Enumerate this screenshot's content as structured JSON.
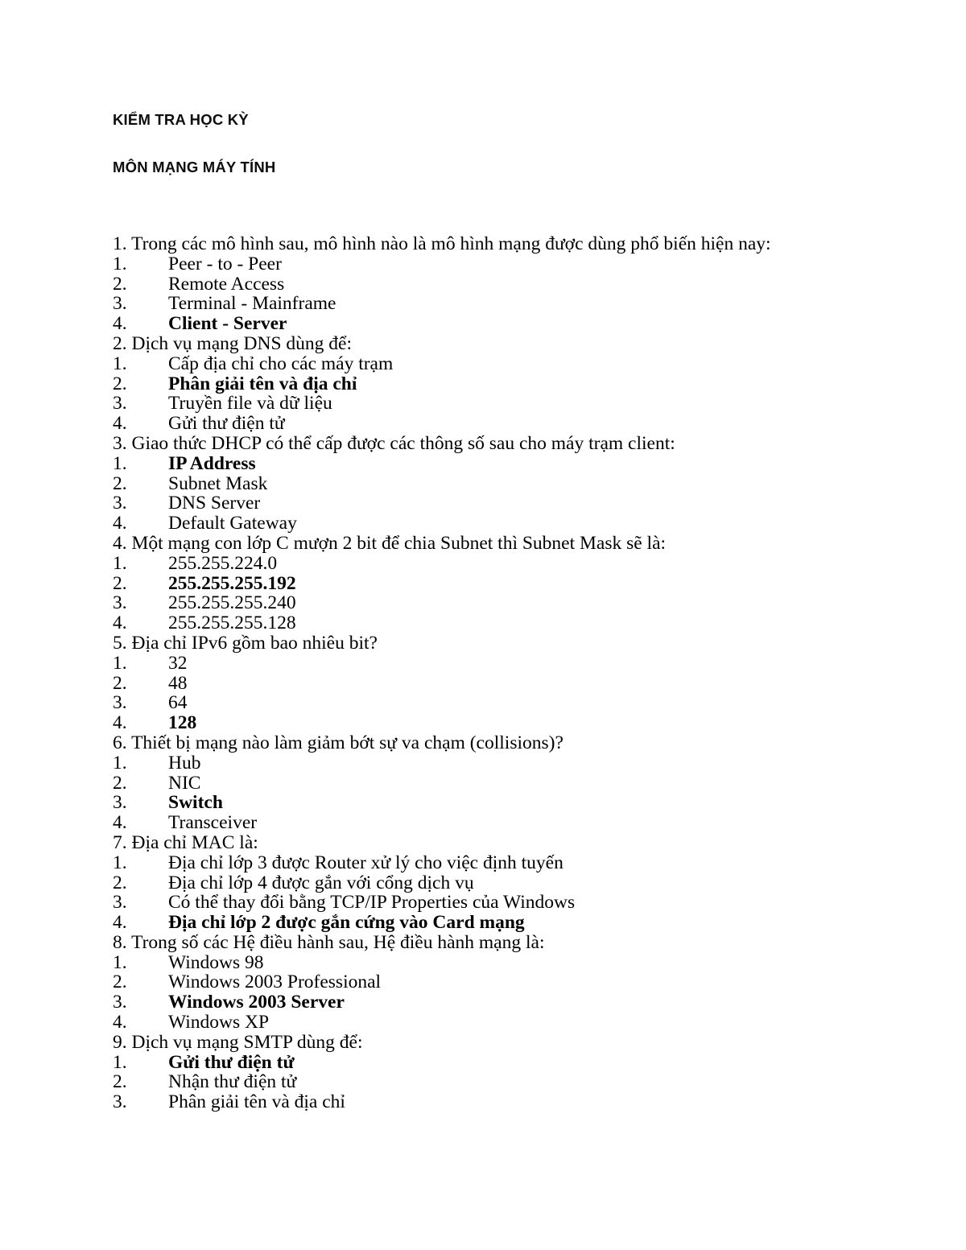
{
  "document": {
    "title_line_1": "KIỂM TRA HỌC KỲ",
    "title_line_2": "MÔN MẠNG MÁY TÍNH"
  },
  "questions": [
    {
      "number": "1.",
      "text": "Trong các mô hình sau, mô hình nào là mô hình mạng được dùng phổ biến hiện nay:",
      "options": [
        {
          "number": "1.",
          "text": "Peer - to - Peer",
          "correct": false
        },
        {
          "number": "2.",
          "text": "Remote Access",
          "correct": false
        },
        {
          "number": "3.",
          "text": "Terminal - Mainframe",
          "correct": false
        },
        {
          "number": "4.",
          "text": "Client - Server",
          "correct": true
        }
      ]
    },
    {
      "number": "2.",
      "text": "Dịch vụ mạng DNS dùng để:",
      "options": [
        {
          "number": "1.",
          "text": "Cấp địa chỉ cho các máy trạm",
          "correct": false
        },
        {
          "number": "2.",
          "text": "Phân giải tên và địa chỉ",
          "correct": true
        },
        {
          "number": "3.",
          "text": "Truyền file và dữ liệu",
          "correct": false
        },
        {
          "number": "4.",
          "text": "Gửi thư điện tử",
          "correct": false
        }
      ]
    },
    {
      "number": "3.",
      "text": "Giao thức DHCP có thể cấp được các thông số sau cho máy trạm client:",
      "options": [
        {
          "number": "1.",
          "text": "IP Address",
          "correct": true
        },
        {
          "number": "2.",
          "text": "Subnet Mask",
          "correct": false
        },
        {
          "number": "3.",
          "text": "DNS Server",
          "correct": false
        },
        {
          "number": "4.",
          "text": "Default Gateway",
          "correct": false
        }
      ]
    },
    {
      "number": "4.",
      "text": "Một mạng con lớp C mượn 2 bit để chia Subnet thì Subnet Mask sẽ là:",
      "options": [
        {
          "number": "1.",
          "text": "255.255.224.0",
          "correct": false
        },
        {
          "number": "2.",
          "text": "255.255.255.192",
          "correct": true
        },
        {
          "number": "3.",
          "text": "255.255.255.240",
          "correct": false
        },
        {
          "number": "4.",
          "text": "255.255.255.128",
          "correct": false
        }
      ]
    },
    {
      "number": "5.",
      "text": "Địa chỉ IPv6 gồm bao nhiêu bit?",
      "options": [
        {
          "number": "1.",
          "text": "32",
          "correct": false
        },
        {
          "number": "2.",
          "text": "48",
          "correct": false
        },
        {
          "number": "3.",
          "text": "64",
          "correct": false
        },
        {
          "number": "4.",
          "text": "128",
          "correct": true
        }
      ]
    },
    {
      "number": "6.",
      "text": "Thiết bị mạng nào làm giảm bớt sự va chạm (collisions)?",
      "options": [
        {
          "number": "1.",
          "text": "Hub",
          "correct": false
        },
        {
          "number": "2.",
          "text": "NIC",
          "correct": false
        },
        {
          "number": "3.",
          "text": "Switch",
          "correct": true
        },
        {
          "number": "4.",
          "text": "Transceiver",
          "correct": false
        }
      ]
    },
    {
      "number": "7.",
      "text": "Địa chỉ MAC là:",
      "options": [
        {
          "number": "1.",
          "text": "Địa chỉ lớp 3 được Router xử lý cho việc định tuyến",
          "correct": false
        },
        {
          "number": "2.",
          "text": "Địa chỉ lớp 4 được gắn với cổng dịch vụ",
          "correct": false
        },
        {
          "number": "3.",
          "text": "Có thể thay đổi bằng TCP/IP Properties của Windows",
          "correct": false
        },
        {
          "number": "4.",
          "text": "Địa chỉ lớp 2 được gắn cứng vào Card mạng",
          "correct": true
        }
      ]
    },
    {
      "number": "8.",
      "text": "Trong số các Hệ điều hành sau, Hệ điều hành mạng là:",
      "options": [
        {
          "number": "1.",
          "text": "Windows 98",
          "correct": false
        },
        {
          "number": "2.",
          "text": "Windows 2003 Professional",
          "correct": false
        },
        {
          "number": "3.",
          "text": "Windows 2003 Server",
          "correct": true
        },
        {
          "number": "4.",
          "text": "Windows XP",
          "correct": false
        }
      ]
    },
    {
      "number": "9.",
      "text": "Dịch vụ mạng SMTP dùng để:",
      "options": [
        {
          "number": "1.",
          "text": "Gửi thư điện tử",
          "correct": true
        },
        {
          "number": "2.",
          "text": "Nhận thư điện tử",
          "correct": false
        },
        {
          "number": "3.",
          "text": "Phân giải tên và địa chỉ",
          "correct": false
        }
      ]
    }
  ]
}
